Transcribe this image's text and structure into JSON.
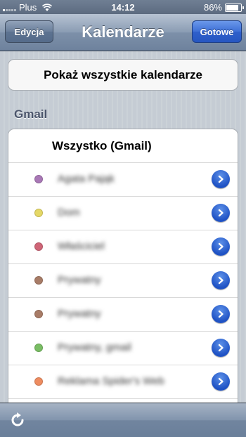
{
  "status_bar": {
    "carrier": "Plus",
    "time": "14:12",
    "battery": "86%",
    "battery_level": 0.86
  },
  "navbar": {
    "title": "Kalendarze",
    "left_button": "Edycja",
    "right_button": "Gotowe"
  },
  "show_all_button": "Pokaż wszystkie kalendarze",
  "section": {
    "header": "Gmail",
    "all_row_label": "Wszystko (Gmail)"
  },
  "calendars": [
    {
      "name": "Agata Pająk",
      "color": "#a978b6"
    },
    {
      "name": "Dom",
      "color": "#e5d866"
    },
    {
      "name": "Właściciel",
      "color": "#cf6577"
    },
    {
      "name": "Prywatny",
      "color": "#a87c67"
    },
    {
      "name": "Prywatny",
      "color": "#a87c67"
    },
    {
      "name": "Prywatny, gmail",
      "color": "#79bd64"
    },
    {
      "name": "Reklama Spider's Web",
      "color": "#ee8c60"
    }
  ],
  "toolbar": {
    "refresh_icon": "refresh-icon"
  },
  "colors": {
    "accent": "#2f60cb",
    "nav": "#6e829d"
  }
}
